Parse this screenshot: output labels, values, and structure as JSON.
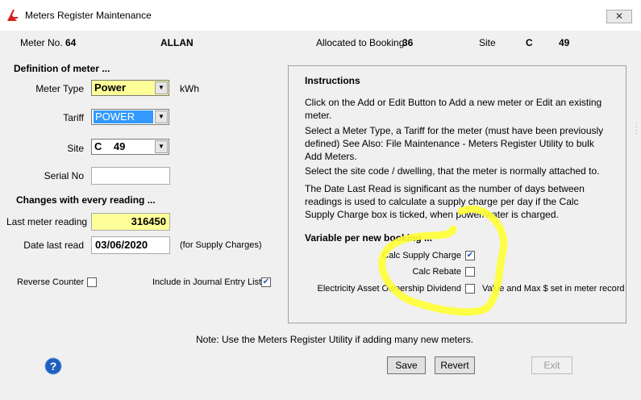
{
  "window": {
    "title": "Meters Register Maintenance",
    "close_label": "✕"
  },
  "header": {
    "meter_no_label": "Meter No.",
    "meter_no": "64",
    "owner": "ALLAN",
    "booking_label": "Allocated to Booking",
    "booking": "36",
    "site_label": "Site",
    "site_code": "C",
    "site_no": "49"
  },
  "definition": {
    "heading": "Definition of meter ...",
    "meter_type_label": "Meter Type",
    "meter_type_value": "Power",
    "meter_unit": "kWh",
    "tariff_label": "Tariff",
    "tariff_value": "POWER",
    "site_label": "Site",
    "site_value": "C    49",
    "serial_label": "Serial No",
    "serial_value": ""
  },
  "changes": {
    "heading": "Changes with every reading ...",
    "last_reading_label": "Last meter reading",
    "last_reading_value": "316450",
    "date_label": "Date last read",
    "date_value": "03/06/2020",
    "date_note": "(for Supply Charges)"
  },
  "options": {
    "reverse_counter_label": "Reverse Counter",
    "reverse_counter_checked": false,
    "journal_label": "Include in Journal Entry List",
    "journal_checked": true
  },
  "instructions": {
    "heading": "Instructions",
    "p1_line1": "Click on the Add or Edit Button to Add a new meter or Edit an existing",
    "p1_line2": "meter.",
    "p2_line1": "Select a Meter Type, a Tariff for the meter (must have been previously",
    "p2_line2": "defined) See Also: File Maintenance - Meters Register Utility to bulk",
    "p2_line3": "Add Meters.",
    "p3_line1": "Select the site code / dwelling, that the meter is normally attached to.",
    "p4_line1": "The Date Last Read is significant as the number of days between",
    "p4_line2": "readings is used to calculate a supply charge per day if the Calc",
    "p4_line3": "Supply Charge box is ticked, when power/water is charged.",
    "variable_heading": "Variable per new booking ...",
    "calc_supply_label": "Calc Supply Charge",
    "calc_supply_checked": true,
    "calc_rebate_label": "Calc Rebate",
    "calc_rebate_checked": false,
    "dividend_label": "Electricity Asset Ownership Dividend",
    "dividend_checked": false,
    "dividend_note": "Value and Max $ set in meter record"
  },
  "footer": {
    "note": "Note: Use the Meters Register Utility if adding many new meters.",
    "save_label": "Save",
    "revert_label": "Revert",
    "exit_label": "Exit"
  },
  "colors": {
    "highlight_field": "#ffff99",
    "tariff_selected": "#3399ff",
    "annotation": "#ffff33",
    "help_icon": "#1f5fbf"
  },
  "icons": {
    "app": "red-a-logo-icon",
    "close": "close-icon",
    "help": "help-icon",
    "dropdown": "chevron-down-icon",
    "check": "checkmark-icon"
  }
}
